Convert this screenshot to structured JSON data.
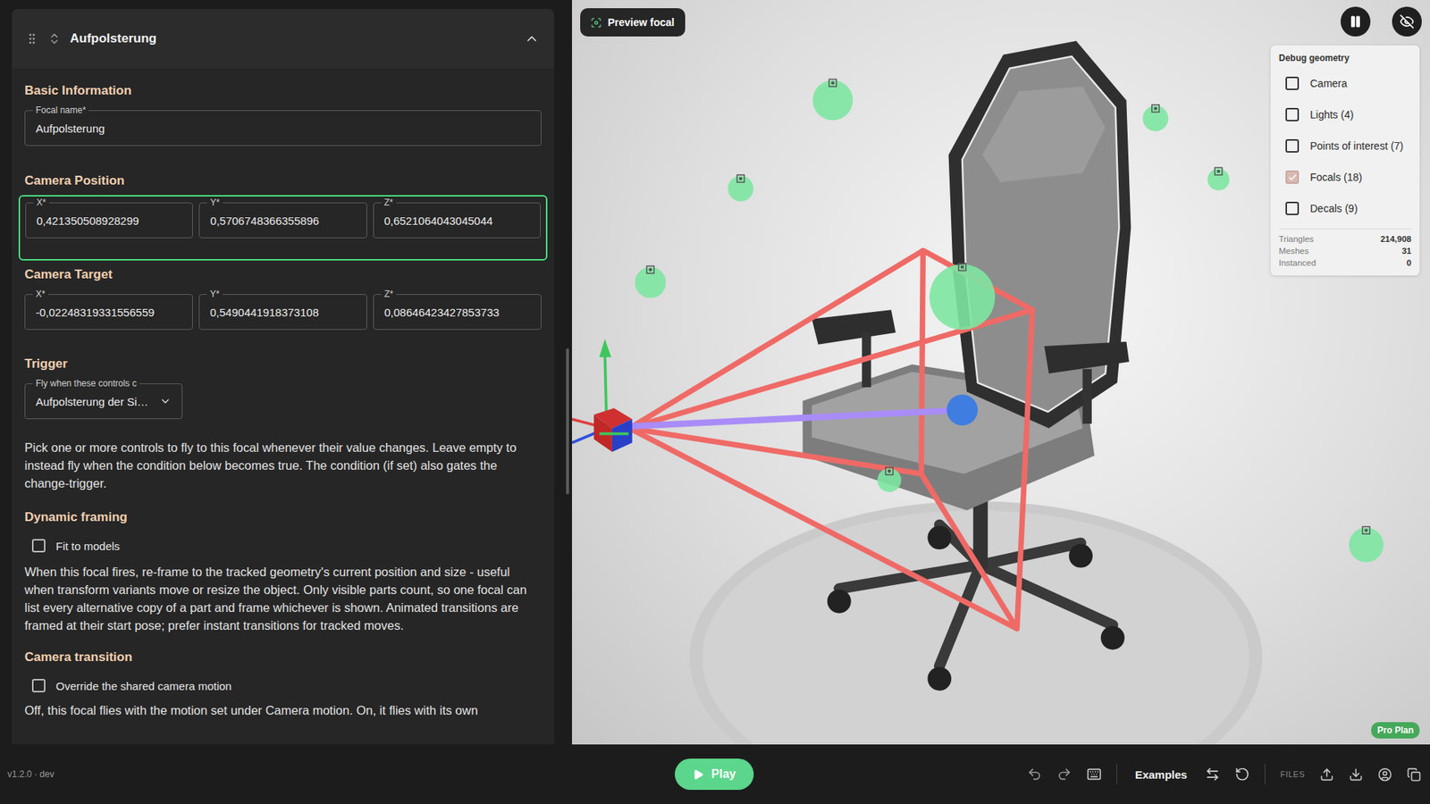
{
  "panel": {
    "title": "Aufpolsterung",
    "expanded": true
  },
  "basic_information": {
    "heading": "Basic Information",
    "focal_name": {
      "label": "Focal name*",
      "value": "Aufpolsterung"
    }
  },
  "camera_position": {
    "heading": "Camera Position",
    "highlighted": true,
    "fields": [
      {
        "label": "X*",
        "value": "0,421350508928299"
      },
      {
        "label": "Y*",
        "value": "0,5706748366355896"
      },
      {
        "label": "Z*",
        "value": "0,6521064043045044"
      }
    ]
  },
  "camera_target": {
    "heading": "Camera Target",
    "highlighted": false,
    "fields": [
      {
        "label": "X*",
        "value": "-0,02248319331556559"
      },
      {
        "label": "Y*",
        "value": "0,5490441918373108"
      },
      {
        "label": "Z*",
        "value": "0,08646423427853733"
      }
    ]
  },
  "trigger": {
    "heading": "Trigger",
    "label": "Fly when these controls c",
    "value": "Aufpolsterung der Si…",
    "help": "Pick one or more controls to fly to this focal whenever their value changes. Leave empty to instead fly when the condition below becomes true. The condition (if set) also gates the change-trigger."
  },
  "dynamic_framing": {
    "heading": "Dynamic framing",
    "checkbox": {
      "label": "Fit to models",
      "checked": false
    },
    "help": "When this focal fires, re-frame to the tracked geometry's current position and size - useful when transform variants move or resize the object. Only visible parts count, so one focal can list every alternative copy of a part and frame whichever is shown. Animated transitions are framed at their start pose; prefer instant transitions for tracked moves."
  },
  "camera_transition": {
    "heading": "Camera transition",
    "checkbox": {
      "label": "Override the shared camera motion",
      "checked": false
    },
    "help": "Off, this focal flies with the motion set under Camera motion. On, it flies with its own"
  },
  "viewport": {
    "preview_button": "Preview focal",
    "badge": "Pro Plan"
  },
  "debug_geometry": {
    "title": "Debug geometry",
    "items": [
      {
        "label": "Camera",
        "checked": false
      },
      {
        "label": "Lights (4)",
        "checked": false
      },
      {
        "label": "Points of interest (7)",
        "checked": false
      },
      {
        "label": "Focals (18)",
        "checked": true
      },
      {
        "label": "Decals (9)",
        "checked": false
      }
    ],
    "stats": [
      {
        "label": "Triangles",
        "value": "214,908"
      },
      {
        "label": "Meshes",
        "value": "31"
      },
      {
        "label": "Instanced",
        "value": "0"
      }
    ]
  },
  "bottom_bar": {
    "version": "v1.2.0 · dev",
    "play": "Play",
    "examples": "Examples",
    "files": "FILES"
  }
}
